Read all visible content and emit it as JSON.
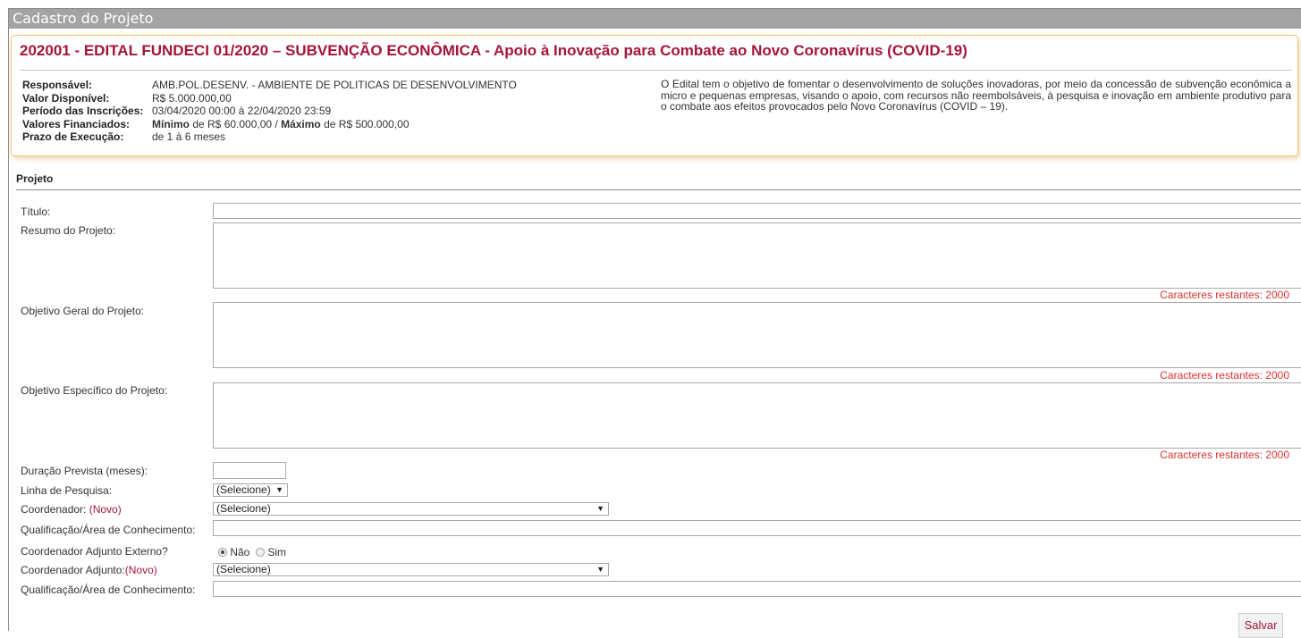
{
  "window": {
    "title": "Cadastro do Projeto"
  },
  "edital": {
    "title": "202001 - EDITAL FUNDECI 01/2020 – SUBVENÇÃO ECONÔMICA - Apoio à Inovação para Combate ao Novo Coronavírus (COVID-19)",
    "info": {
      "responsavel_label": "Responsável:",
      "responsavel_value": "AMB.POL.DESENV. - AMBIENTE DE POLITICAS DE DESENVOLVIMENTO",
      "valor_label": "Valor Disponível:",
      "valor_value": "R$ 5.000.000,00",
      "periodo_label": "Período das Inscrições:",
      "periodo_value": "03/04/2020 00:00 à 22/04/2020 23:59",
      "valores_label": "Valores Financiados:",
      "valores_min_label": "Mínimo",
      "valores_min_value": " de R$ 60.000,00 / ",
      "valores_max_label": "Máximo",
      "valores_max_value": " de R$ 500.000,00",
      "prazo_label": "Prazo de Execução:",
      "prazo_value": "de 1 à 6 meses"
    },
    "description": "O Edital tem o objetivo de fomentar o desenvolvimento de soluções inovadoras, por meio da concessão de subvenção econômica a micro e pequenas empresas, visando o apoio, com recursos não reembolsáveis, à pesquisa e inovação em ambiente produtivo para o combate aos efeitos provocados pelo Novo Coronavírus (COVID – 19)."
  },
  "form": {
    "section_title": "Projeto",
    "titulo_label": "Título:",
    "titulo_value": "",
    "resumo_label": "Resumo do Projeto:",
    "resumo_value": "",
    "resumo_chars": "Caracteres restantes: 2000",
    "obj_geral_label": "Objetivo Geral do Projeto:",
    "obj_geral_value": "",
    "obj_geral_chars": "Caracteres restantes: 2000",
    "obj_esp_label": "Objetivo Específico do Projeto:",
    "obj_esp_value": "",
    "obj_esp_chars": "Caracteres restantes: 2000",
    "duracao_label": "Duração Prevista (meses):",
    "duracao_value": "",
    "linha_label": "Linha de Pesquisa:",
    "linha_selected": "(Selecione)",
    "coord_label": "Coordenador: ",
    "coord_novo": "(Novo)",
    "coord_selected": "(Selecione)",
    "qualif1_label": "Qualificação/Área de Conhecimento:",
    "qualif1_value": "",
    "adjunto_ext_label": "Coordenador Adjunto Externo?",
    "radio_nao": "Não",
    "radio_sim": "Sim",
    "radio_selected": "Não",
    "adjunto_label": "Coordenador Adjunto:",
    "adjunto_novo": "(Novo)",
    "adjunto_selected": "(Selecione)",
    "qualif2_label": "Qualificação/Área de Conhecimento:",
    "qualif2_value": "",
    "save_label": "Salvar"
  },
  "colors": {
    "accent": "#a4153a",
    "warning_text": "#e03232",
    "titlebar_bg": "#a3a3a3",
    "edital_border": "#f0c66c"
  }
}
